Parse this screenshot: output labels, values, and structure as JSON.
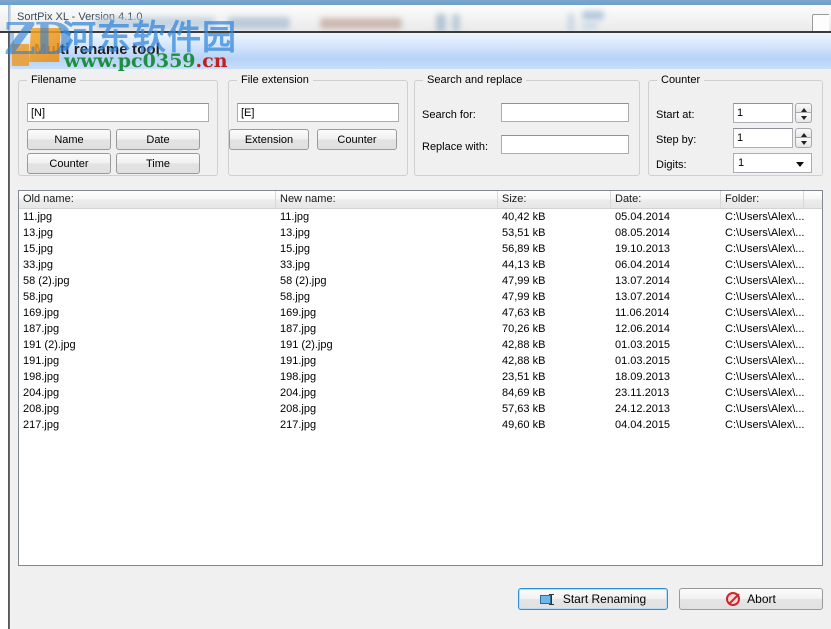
{
  "window": {
    "title": "SortPix XL - Version 4.1.0",
    "banner_title": "Multi rename tool"
  },
  "watermark": {
    "logo_text": "ZD",
    "site_name_cn": "河东软件园",
    "url_prefix": "www.pc0359",
    "url_domain": ".cn"
  },
  "filename_group": {
    "legend": "Filename",
    "pattern_value": "[N]",
    "buttons": [
      "Name",
      "Date",
      "Counter",
      "Time"
    ]
  },
  "extension_group": {
    "legend": "File extension",
    "pattern_value": "[E]",
    "buttons": [
      "Extension",
      "Counter"
    ]
  },
  "search_replace_group": {
    "legend": "Search and replace",
    "search_label": "Search for:",
    "search_value": "",
    "replace_label": "Replace with:",
    "replace_value": ""
  },
  "counter_group": {
    "legend": "Counter",
    "start_label": "Start at:",
    "start_value": "1",
    "step_label": "Step by:",
    "step_value": "1",
    "digits_label": "Digits:",
    "digits_value": "1"
  },
  "file_list": {
    "columns": [
      "Old name:",
      "New name:",
      "Size:",
      "Date:",
      "Folder:",
      ""
    ],
    "rows": [
      {
        "old": "11.jpg",
        "new": "11.jpg",
        "size": "40,42 kB",
        "date": "05.04.2014",
        "folder": "C:\\Users\\Alex\\..."
      },
      {
        "old": "13.jpg",
        "new": "13.jpg",
        "size": "53,51 kB",
        "date": "08.05.2014",
        "folder": "C:\\Users\\Alex\\..."
      },
      {
        "old": "15.jpg",
        "new": "15.jpg",
        "size": "56,89 kB",
        "date": "19.10.2013",
        "folder": "C:\\Users\\Alex\\..."
      },
      {
        "old": "33.jpg",
        "new": "33.jpg",
        "size": "44,13 kB",
        "date": "06.04.2014",
        "folder": "C:\\Users\\Alex\\..."
      },
      {
        "old": "58 (2).jpg",
        "new": "58 (2).jpg",
        "size": "47,99 kB",
        "date": "13.07.2014",
        "folder": "C:\\Users\\Alex\\..."
      },
      {
        "old": "58.jpg",
        "new": "58.jpg",
        "size": "47,99 kB",
        "date": "13.07.2014",
        "folder": "C:\\Users\\Alex\\..."
      },
      {
        "old": "169.jpg",
        "new": "169.jpg",
        "size": "47,63 kB",
        "date": "11.06.2014",
        "folder": "C:\\Users\\Alex\\..."
      },
      {
        "old": "187.jpg",
        "new": "187.jpg",
        "size": "70,26 kB",
        "date": "12.06.2014",
        "folder": "C:\\Users\\Alex\\..."
      },
      {
        "old": "191 (2).jpg",
        "new": "191 (2).jpg",
        "size": "42,88 kB",
        "date": "01.03.2015",
        "folder": "C:\\Users\\Alex\\..."
      },
      {
        "old": "191.jpg",
        "new": "191.jpg",
        "size": "42,88 kB",
        "date": "01.03.2015",
        "folder": "C:\\Users\\Alex\\..."
      },
      {
        "old": "198.jpg",
        "new": "198.jpg",
        "size": "23,51 kB",
        "date": "18.09.2013",
        "folder": "C:\\Users\\Alex\\..."
      },
      {
        "old": "204.jpg",
        "new": "204.jpg",
        "size": "84,69 kB",
        "date": "23.11.2013",
        "folder": "C:\\Users\\Alex\\..."
      },
      {
        "old": "208.jpg",
        "new": "208.jpg",
        "size": "57,63 kB",
        "date": "24.12.2013",
        "folder": "C:\\Users\\Alex\\..."
      },
      {
        "old": "217.jpg",
        "new": "217.jpg",
        "size": "49,60 kB",
        "date": "04.04.2015",
        "folder": "C:\\Users\\Alex\\..."
      }
    ]
  },
  "actions": {
    "start_label": "Start Renaming",
    "abort_label": "Abort"
  },
  "colors": {
    "banner_blue": "#b5d2f7",
    "default_button_border": "#2f8fd8",
    "abort_red": "#d0252b"
  }
}
